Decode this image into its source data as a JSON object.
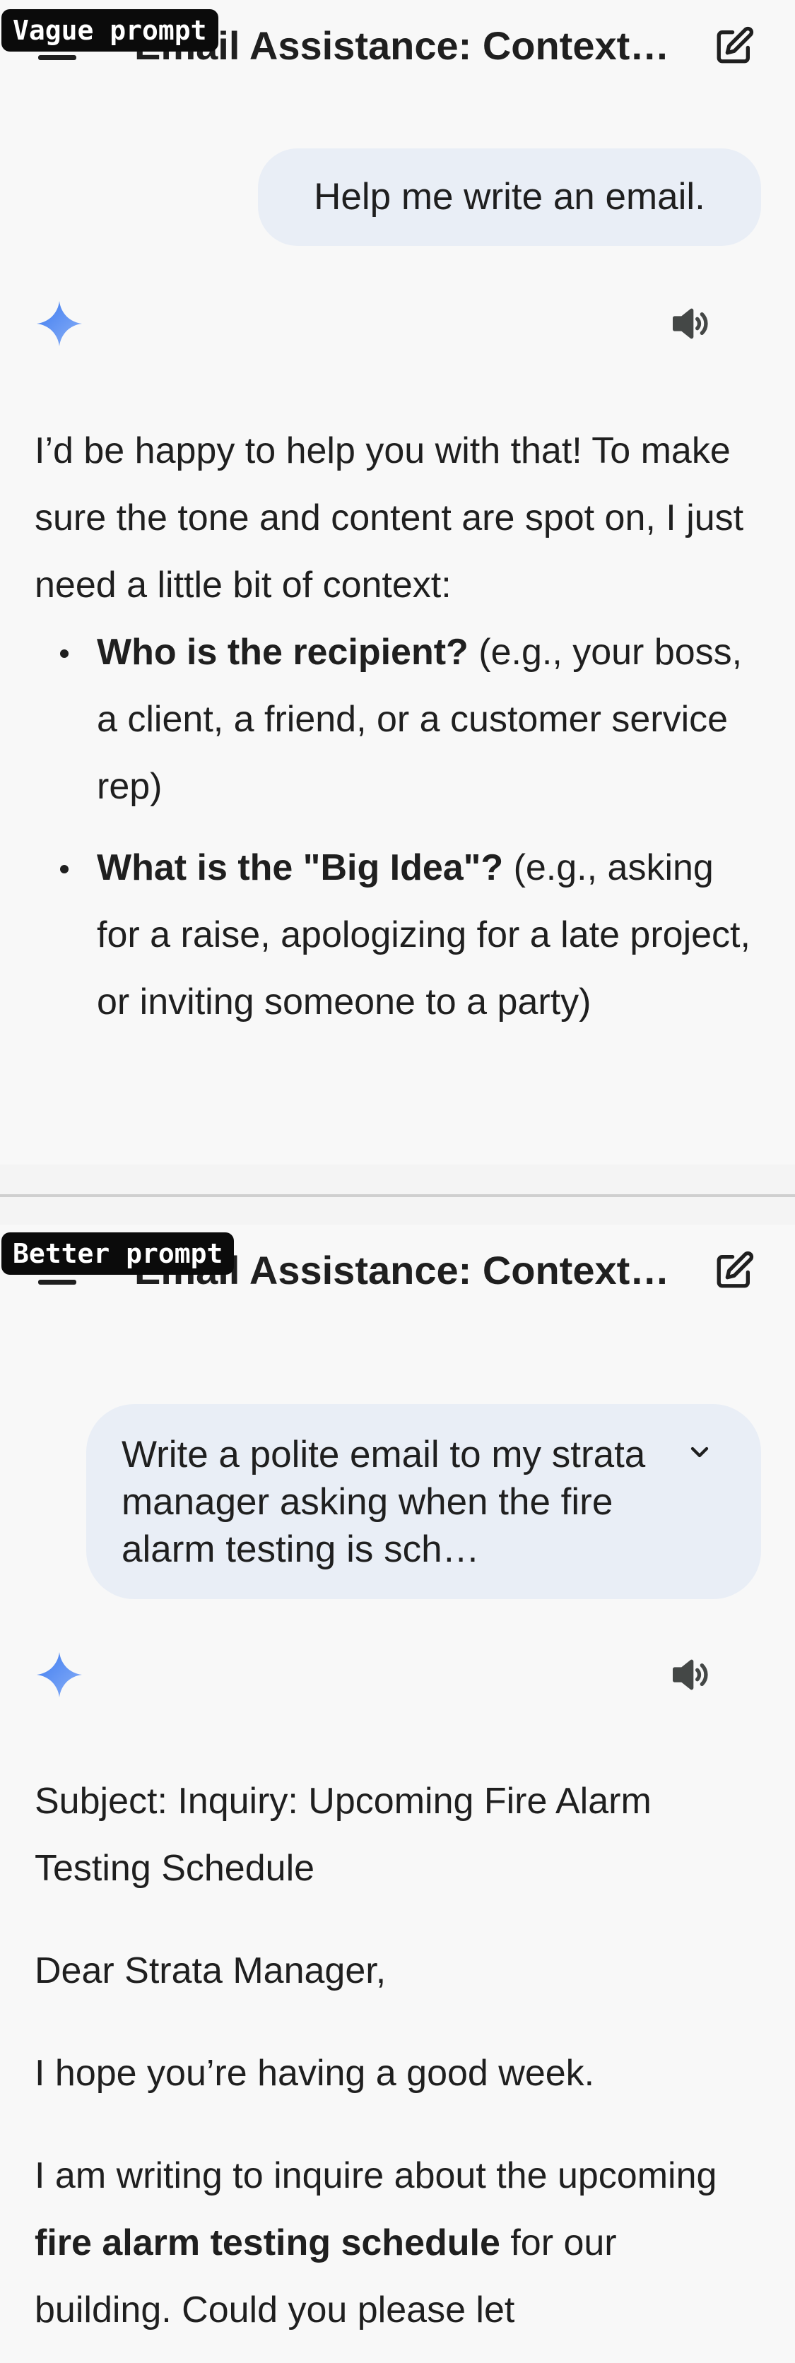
{
  "labels": {
    "vague": "Vague prompt",
    "better": "Better prompt"
  },
  "header": {
    "title": "Email Assistance: Context…",
    "menu_icon": "menu-icon",
    "edit_icon": "new-chat-icon"
  },
  "vague": {
    "user_message": "Help me write an email.",
    "response": {
      "intro": "I’d be happy to help you with that! To make sure the tone and content are spot on, I just need a little bit of context:",
      "bullets": [
        {
          "bold": "Who is the recipient?",
          "text": " (e.g., your boss, a client, a friend, or a customer service rep)"
        },
        {
          "bold": "What is the \"Big Idea\"?",
          "text": " (e.g., asking for a raise, apologizing for a late project, or inviting someone to a party)"
        }
      ]
    }
  },
  "better": {
    "user_message": "Write a polite email to my strata manager asking when the fire alarm testing is sch…",
    "response": {
      "subject": "Subject: Inquiry: Upcoming Fire Alarm Testing Schedule",
      "greeting": "Dear Strata Manager,",
      "line1": "I hope you’re having a good week.",
      "para_before": "I am writing to inquire about the upcoming ",
      "para_bold": "fire alarm testing schedule",
      "para_after": " for our building. Could you please let"
    }
  },
  "colors": {
    "background": "#f8f8f8",
    "user_bubble": "#e9eef6",
    "gemini_gradient_start": "#4a86f7",
    "gemini_gradient_end": "#7da7f5",
    "label_bg": "#0b0b0b"
  }
}
